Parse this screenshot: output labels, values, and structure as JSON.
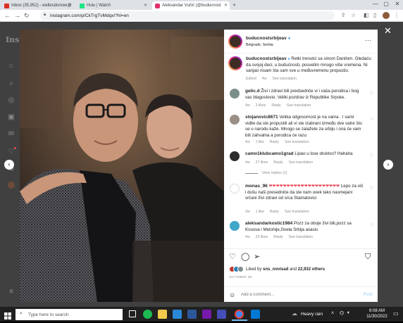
{
  "browser": {
    "tabs": [
      {
        "label": "Inbox (35,952) - wellesdonree@",
        "favicon_color": "#d93025",
        "active": false
      },
      {
        "label": "Hulu | Watch",
        "favicon_color": "#1ce783",
        "active": false
      },
      {
        "label": "Aleksandar Vučić (@buducnost",
        "favicon_color": "#e1306c",
        "active": true
      }
    ],
    "new_tab": "+",
    "url": "instagram.com/p/CkTrgTvMdqx/?hl=en",
    "window_controls": [
      "—",
      "▢",
      "✕"
    ],
    "nav_icons": [
      "back-icon",
      "forward-icon",
      "reload-icon"
    ]
  },
  "instagram": {
    "logo": "Insta",
    "close": "✕",
    "prev": "‹",
    "next": "›"
  },
  "post": {
    "author": "buducnostsrbijeav",
    "verified": "●",
    "location": "Belgrade, Serbia",
    "more": "···",
    "caption": "Retki trenutci sa sinom Danilom. Gledaću da svojoj deci, u budućnosti, posvetim mnogo više vremena. Ni sanjao nisam šta sam sve u međuvremenu propustio.",
    "caption_meta": [
      "Edited",
      "4w",
      "See translation"
    ],
    "comments": [
      {
        "user": "gelic.d",
        "text": "Živi i zdravi bili predsednče vi i vaša porodica i bog vas blagoslovio. Veliki pozdrav iz Republike Srpske.",
        "meta": [
          "4w",
          "3 likes",
          "Reply",
          "See translation"
        ],
        "avatar_color": "#7a8e8a"
      },
      {
        "user": "stojanovic8671",
        "text": "Velika odgovornost je na vama . I sami vidite da ste propustili ali vi ste izabrani između dve vatre što se u narodu kaže. Mnogo se zalažete za srbiju i ona će vam biti zahvalna a porodica će razu",
        "meta": [
          "4w",
          "1 like",
          "Reply",
          "See translation"
        ],
        "avatar_color": "#9a8f86"
      },
      {
        "user": "camo1klubcamo1grad",
        "text": "Lipao u lose druktvo? Hahaha",
        "meta": [
          "4w",
          "27 likes",
          "Reply",
          "See translation"
        ],
        "avatar_color": "#2d2d2d"
      },
      {
        "user": "monas_96",
        "text": "Lepo za oči i dušu naši presedniče da ste nam uvek tako nasmejani srčani živi zdravi od srca Stamatovici",
        "hearts": "❤❤❤❤❤❤❤❤❤❤❤❤❤❤❤❤❤❤❤❤",
        "meta": [
          "3w",
          "1 like",
          "Reply",
          "See translation"
        ],
        "avatar_color": "#ffffff"
      },
      {
        "user": "aleksandarkostic1984",
        "text": "Pozz za oboje živi bili,pozz sa Kosova i Metohije,živela Srbija asasis",
        "meta": [
          "4w",
          "22 likes",
          "Reply",
          "See translation"
        ],
        "avatar_color": "#3fa7c9"
      }
    ],
    "view_replies": "View replies (1)",
    "liked_by_prefix": "Liked by",
    "liked_by_user": "sns_novisad",
    "liked_and": "and",
    "likes_count": "22,932 others",
    "date": "OCTOBER 28",
    "add_comment_placeholder": "Add a comment...",
    "post_button": "Post"
  },
  "taskbar": {
    "search_placeholder": "Type here to search",
    "weather": "Heavy rain",
    "time": "6:08 AM",
    "date": "11/30/2022"
  }
}
